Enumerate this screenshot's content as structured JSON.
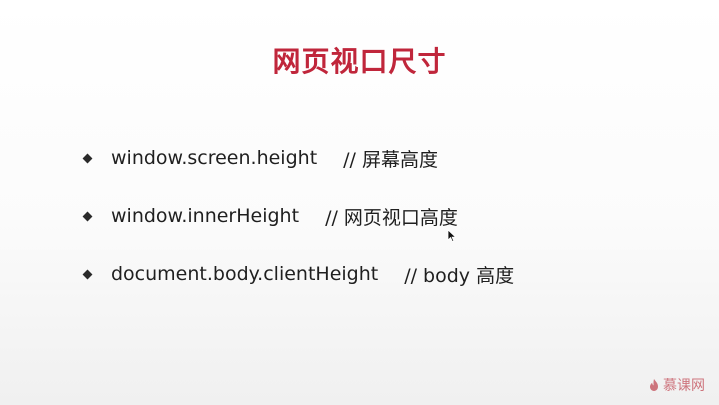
{
  "slide": {
    "title": "网页视口尺寸",
    "bullets": [
      {
        "code": "window.screen.height",
        "comment": "// 屏幕高度"
      },
      {
        "code": "window.innerHeight",
        "comment": "// 网页视口高度"
      },
      {
        "code": "document.body.clientHeight",
        "comment": "// body 高度"
      }
    ]
  },
  "watermark": {
    "text": "慕课网",
    "icon": "flame-logo-icon"
  },
  "colors": {
    "title": "#c0263b",
    "text": "#1f1f1f",
    "watermark": "#c24b56"
  }
}
